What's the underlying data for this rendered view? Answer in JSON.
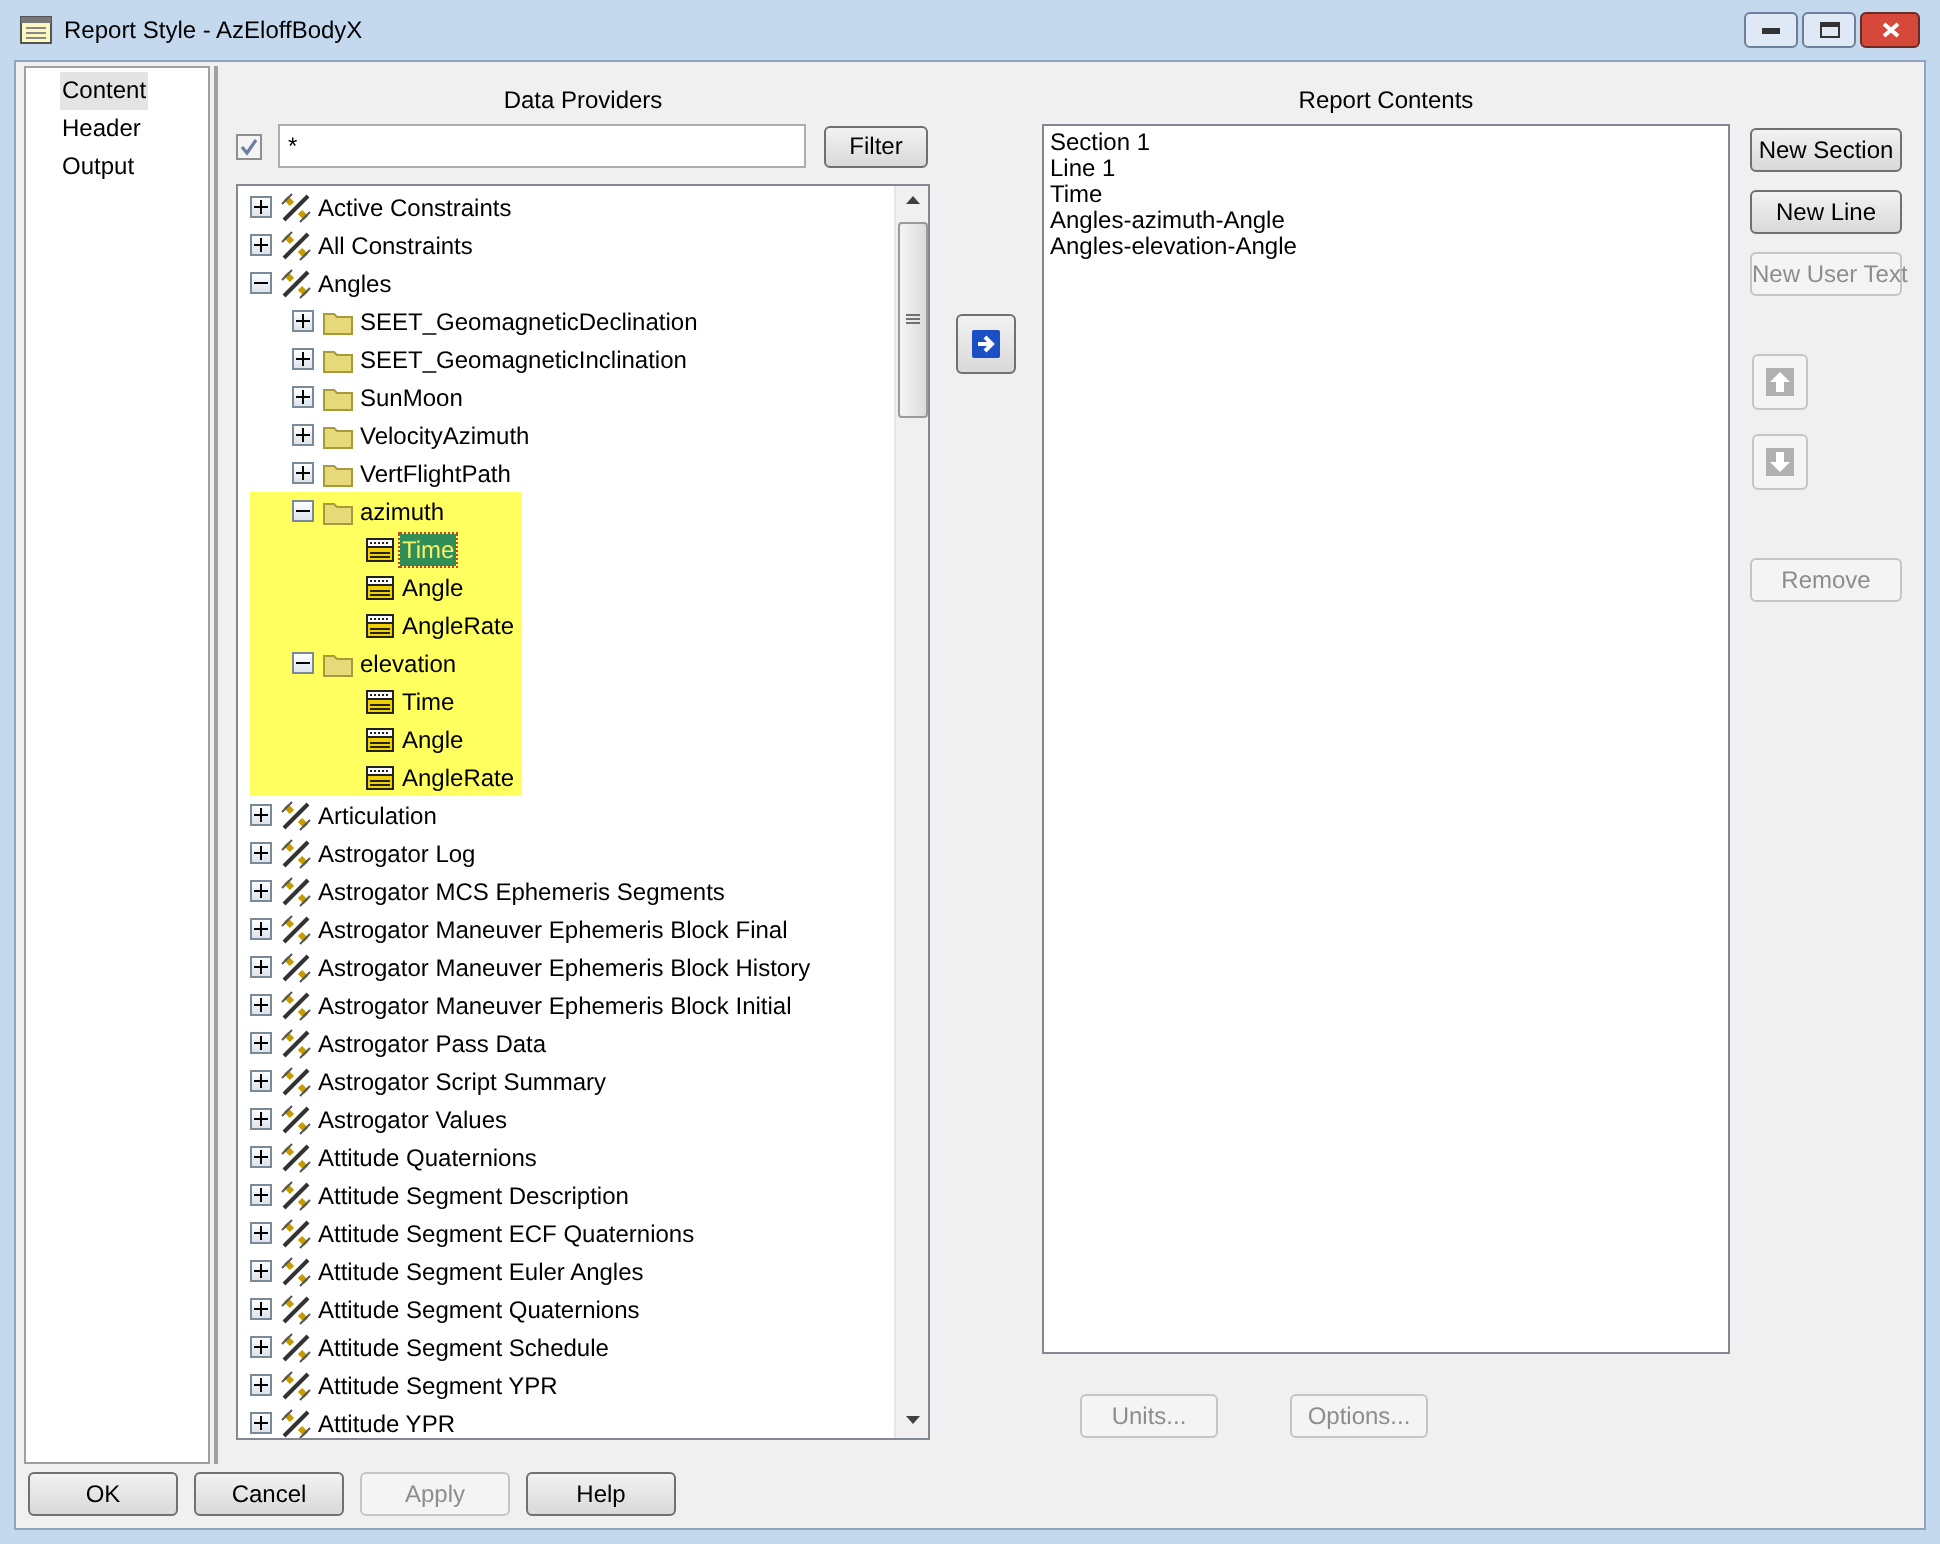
{
  "window": {
    "title": "Report Style - AzEloffBodyX"
  },
  "nav": [
    {
      "label": "Content",
      "selected": true
    },
    {
      "label": "Header",
      "selected": false
    },
    {
      "label": "Output",
      "selected": false
    }
  ],
  "data_providers": {
    "heading": "Data Providers",
    "filter_enabled": true,
    "filter_value": "*",
    "filter_button": "Filter",
    "tree": [
      {
        "label": "Active Constraints",
        "kind": "satellite",
        "expanded": false,
        "selected": false
      },
      {
        "label": "All Constraints",
        "kind": "satellite",
        "expanded": false,
        "selected": false
      },
      {
        "label": "Angles",
        "kind": "satellite",
        "expanded": true,
        "selected": false,
        "children": [
          {
            "label": "SEET_GeomagneticDeclination",
            "kind": "folder",
            "expanded": false,
            "selected": false,
            "highlighted": false
          },
          {
            "label": "SEET_GeomagneticInclination",
            "kind": "folder",
            "expanded": false,
            "selected": false,
            "highlighted": false
          },
          {
            "label": "SunMoon",
            "kind": "folder",
            "expanded": false,
            "selected": false,
            "highlighted": false
          },
          {
            "label": "VelocityAzimuth",
            "kind": "folder",
            "expanded": false,
            "selected": false,
            "highlighted": false
          },
          {
            "label": "VertFlightPath",
            "kind": "folder",
            "expanded": false,
            "selected": false,
            "highlighted": false
          },
          {
            "label": "azimuth",
            "kind": "folder",
            "expanded": true,
            "selected": false,
            "highlighted": true,
            "children": [
              {
                "label": "Time",
                "kind": "element",
                "selected": true
              },
              {
                "label": "Angle",
                "kind": "element",
                "selected": false
              },
              {
                "label": "AngleRate",
                "kind": "element",
                "selected": false
              }
            ]
          },
          {
            "label": "elevation",
            "kind": "folder",
            "expanded": true,
            "selected": false,
            "highlighted": true,
            "children": [
              {
                "label": "Time",
                "kind": "element",
                "selected": false
              },
              {
                "label": "Angle",
                "kind": "element",
                "selected": false
              },
              {
                "label": "AngleRate",
                "kind": "element",
                "selected": false
              }
            ]
          }
        ]
      },
      {
        "label": "Articulation",
        "kind": "satellite",
        "expanded": false,
        "selected": false
      },
      {
        "label": "Astrogator Log",
        "kind": "satellite",
        "expanded": false,
        "selected": false
      },
      {
        "label": "Astrogator MCS Ephemeris Segments",
        "kind": "satellite",
        "expanded": false,
        "selected": false
      },
      {
        "label": "Astrogator Maneuver Ephemeris Block Final",
        "kind": "satellite",
        "expanded": false,
        "selected": false
      },
      {
        "label": "Astrogator Maneuver Ephemeris Block History",
        "kind": "satellite",
        "expanded": false,
        "selected": false
      },
      {
        "label": "Astrogator Maneuver Ephemeris Block Initial",
        "kind": "satellite",
        "expanded": false,
        "selected": false
      },
      {
        "label": "Astrogator Pass Data",
        "kind": "satellite",
        "expanded": false,
        "selected": false
      },
      {
        "label": "Astrogator Script Summary",
        "kind": "satellite",
        "expanded": false,
        "selected": false
      },
      {
        "label": "Astrogator Values",
        "kind": "satellite",
        "expanded": false,
        "selected": false
      },
      {
        "label": "Attitude Quaternions",
        "kind": "satellite",
        "expanded": false,
        "selected": false
      },
      {
        "label": "Attitude Segment Description",
        "kind": "satellite",
        "expanded": false,
        "selected": false
      },
      {
        "label": "Attitude Segment ECF Quaternions",
        "kind": "satellite",
        "expanded": false,
        "selected": false
      },
      {
        "label": "Attitude Segment Euler Angles",
        "kind": "satellite",
        "expanded": false,
        "selected": false
      },
      {
        "label": "Attitude Segment Quaternions",
        "kind": "satellite",
        "expanded": false,
        "selected": false
      },
      {
        "label": "Attitude Segment Schedule",
        "kind": "satellite",
        "expanded": false,
        "selected": false
      },
      {
        "label": "Attitude Segment YPR",
        "kind": "satellite",
        "expanded": false,
        "selected": false
      },
      {
        "label": "Attitude YPR",
        "kind": "satellite",
        "expanded": false,
        "selected": false
      }
    ]
  },
  "report_contents": {
    "heading": "Report Contents",
    "items": [
      "Section 1",
      "Line 1",
      "Time",
      "Angles-azimuth-Angle",
      "Angles-elevation-Angle"
    ]
  },
  "side_buttons": [
    {
      "label": "New Section",
      "disabled": false
    },
    {
      "label": "New Line",
      "disabled": false
    },
    {
      "label": "New User Text",
      "disabled": true
    }
  ],
  "move_buttons": [
    {
      "kind": "up",
      "disabled": true
    },
    {
      "kind": "down",
      "disabled": true
    }
  ],
  "remove_button": {
    "label": "Remove",
    "disabled": true
  },
  "list_buttons": [
    {
      "label": "Units...",
      "disabled": true
    },
    {
      "label": "Options...",
      "disabled": true
    }
  ],
  "footer_buttons": [
    {
      "label": "OK",
      "disabled": false
    },
    {
      "label": "Cancel",
      "disabled": false
    },
    {
      "label": "Apply",
      "disabled": true
    },
    {
      "label": "Help",
      "disabled": false
    }
  ]
}
